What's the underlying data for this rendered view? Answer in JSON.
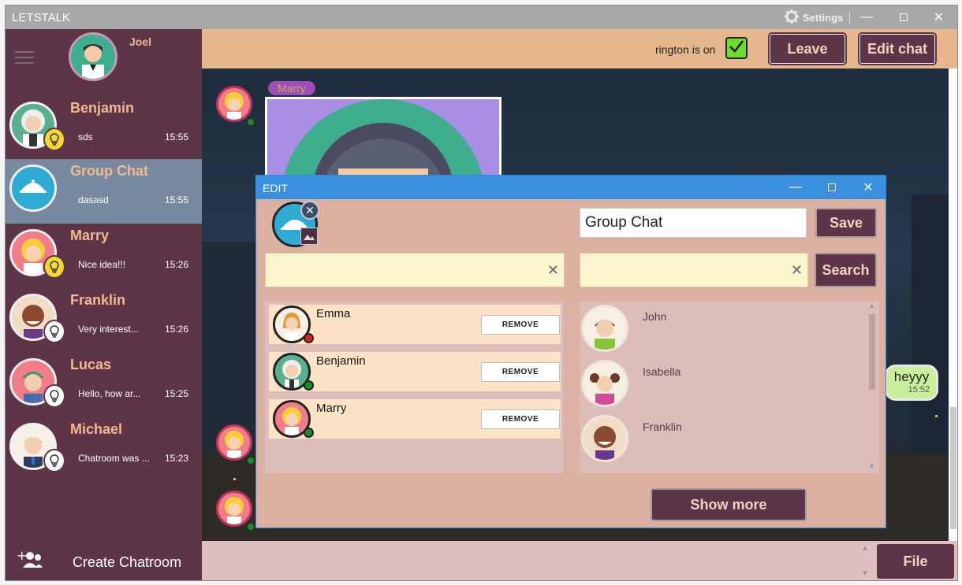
{
  "window": {
    "title": "LETSTALK",
    "settings_label": "Settings"
  },
  "me": {
    "name": "Joel"
  },
  "chats": [
    {
      "name": "Benjamin",
      "last": "sds",
      "time": "15:55",
      "bulb": "on",
      "active": false
    },
    {
      "name": "Group Chat",
      "last": "dasasd",
      "time": "15:55",
      "bulb": "none",
      "active": true
    },
    {
      "name": "Marry",
      "last": "Nice idea!!!",
      "time": "15:26",
      "bulb": "on",
      "active": false
    },
    {
      "name": "Franklin",
      "last": "Very interest...",
      "time": "15:26",
      "bulb": "off",
      "active": false
    },
    {
      "name": "Lucas",
      "last": "Hello, how ar...",
      "time": "15:25",
      "bulb": "off",
      "active": false
    },
    {
      "name": "Michael",
      "last": "Chatroom was ...",
      "time": "15:23",
      "bulb": "off",
      "active": false
    }
  ],
  "sidebar": {
    "create_label": "Create Chatroom"
  },
  "topbar": {
    "ringtone_label": "rington is on",
    "ringtone_on": true,
    "leave_label": "Leave",
    "edit_label": "Edit chat"
  },
  "chat": {
    "sender_label": "Marry",
    "my_message": "heyyy",
    "my_message_time": "15:52"
  },
  "input": {
    "file_label": "File"
  },
  "edit_dialog": {
    "title": "EDIT",
    "name_value": "Group Chat",
    "save_label": "Save",
    "search_label": "Search",
    "show_more_label": "Show more",
    "members": [
      {
        "name": "Emma",
        "status": "offline",
        "remove_label": "REMOVE"
      },
      {
        "name": "Benjamin",
        "status": "online",
        "remove_label": "REMOVE"
      },
      {
        "name": "Marry",
        "status": "online",
        "remove_label": "REMOVE"
      }
    ],
    "users": [
      {
        "name": "John"
      },
      {
        "name": "Isabella"
      },
      {
        "name": "Franklin"
      }
    ]
  },
  "colors": {
    "sidebar": "#5e3448",
    "accent_text": "#f3b98e",
    "topbar": "#e6b78c",
    "button": "#5e3448",
    "dialog_bg": "#dbb0a1",
    "dialog_title": "#3a90de",
    "online": "#1e8b2a",
    "offline": "#e02020",
    "bulb_on": "#f3d833"
  }
}
